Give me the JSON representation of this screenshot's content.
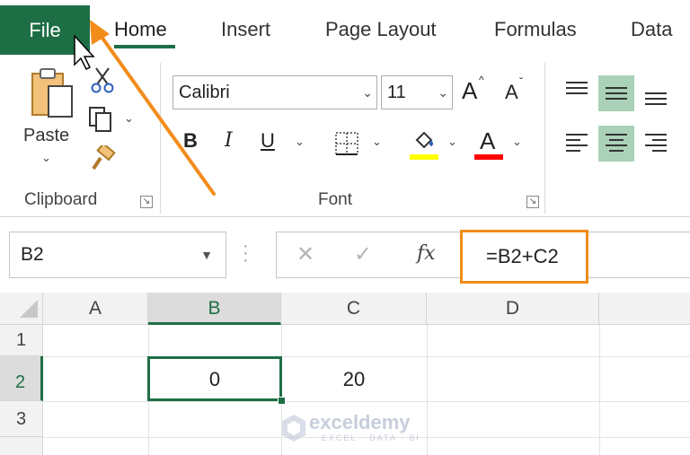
{
  "tabs": {
    "file": "File",
    "home": "Home",
    "insert": "Insert",
    "page_layout": "Page Layout",
    "formulas": "Formulas",
    "data": "Data"
  },
  "ribbon": {
    "clipboard": {
      "paste_label": "Paste",
      "group_label": "Clipboard"
    },
    "font": {
      "font_name": "Calibri",
      "font_size": "11",
      "bold": "B",
      "italic": "I",
      "underline": "U",
      "font_color_glyph": "A",
      "grow_font": "A",
      "shrink_font": "A",
      "group_label": "Font",
      "highlight_color": "#ffff00",
      "font_color": "#ff0000"
    }
  },
  "formula_bar": {
    "name_box": "B2",
    "cancel": "✕",
    "enter": "✓",
    "fx": "fx",
    "formula": "=B2+C2"
  },
  "grid": {
    "columns": [
      "A",
      "B",
      "C",
      "D"
    ],
    "rows": [
      "1",
      "2",
      "3"
    ],
    "cells": {
      "B2": "0",
      "C2": "20"
    },
    "selected_cell": "B2"
  },
  "watermark": {
    "name": "exceldemy",
    "tagline": "EXCEL · DATA · BI"
  },
  "colors": {
    "accent": "#1e6e45",
    "annotation": "#f28c1b",
    "active_align": "#a9d2b9"
  }
}
